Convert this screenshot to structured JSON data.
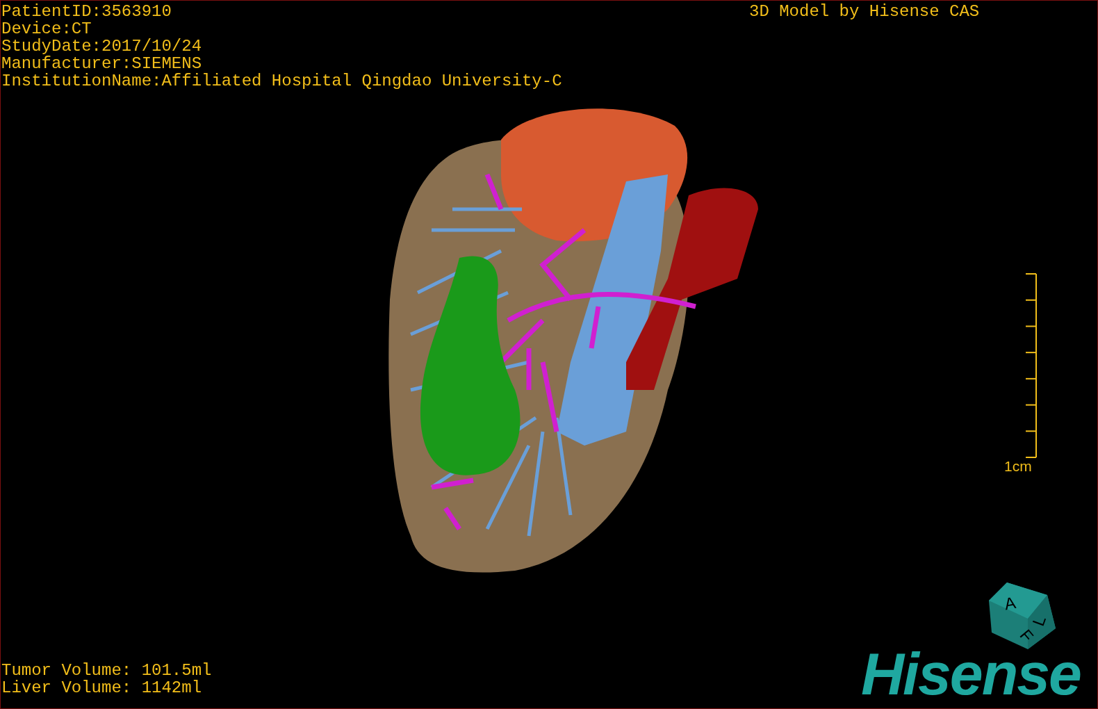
{
  "patient_info": [
    "PatientID:3563910",
    "Device:CT",
    "StudyDate:2017/10/24",
    "Manufacturer:SIEMENS",
    "InstitutionName:Affiliated Hospital Qingdao University-C"
  ],
  "header_right": "3D Model by Hisense CAS",
  "scale_bar": {
    "label": "1cm"
  },
  "orientation_cube": {
    "labels": [
      "A",
      "F",
      "L"
    ]
  },
  "volumes": [
    "Tumor Volume: 101.5ml",
    "Liver Volume: 1142ml"
  ],
  "logo": "Hisense"
}
